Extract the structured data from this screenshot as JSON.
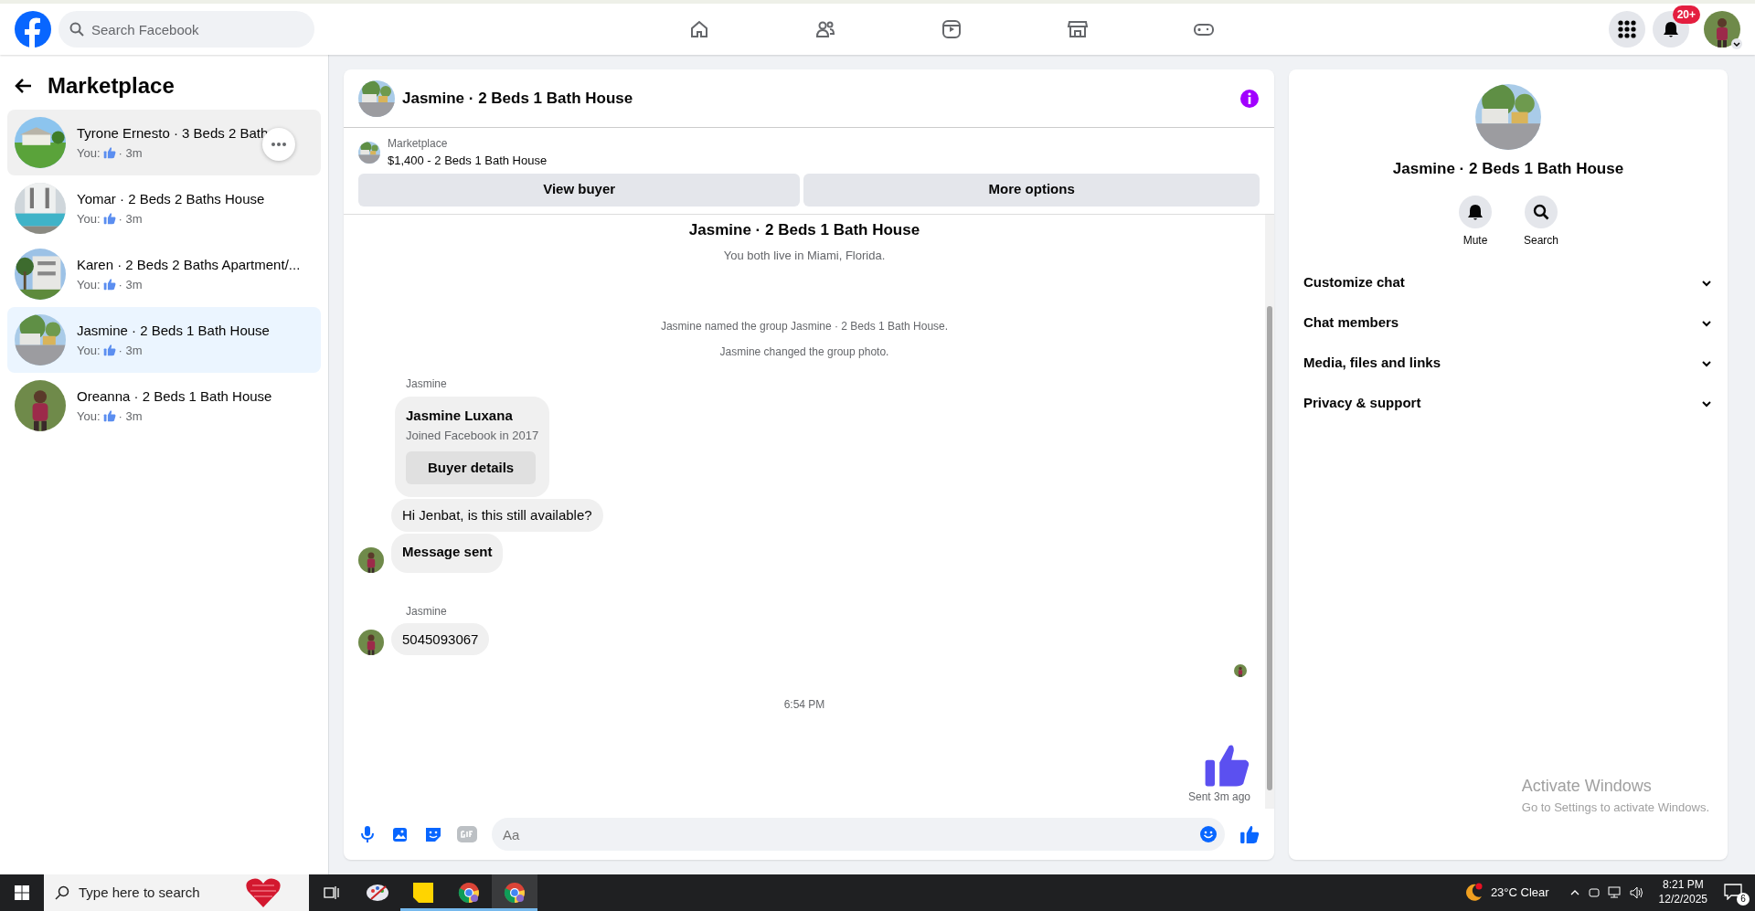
{
  "topbar": {
    "search_placeholder": "Search Facebook",
    "notification_badge": "20+"
  },
  "sidebar": {
    "title": "Marketplace",
    "conversations": [
      {
        "title": "Tyrone Ernesto · 3 Beds 2 Bath",
        "preview": "You:",
        "time": "· 3m",
        "hovered": true,
        "selected": false
      },
      {
        "title": "Yomar · 2 Beds 2 Baths House",
        "preview": "You:",
        "time": "· 3m",
        "hovered": false,
        "selected": false
      },
      {
        "title": "Karen · 2 Beds 2 Baths Apartment/...",
        "preview": "You:",
        "time": "· 3m",
        "hovered": false,
        "selected": false
      },
      {
        "title": "Jasmine · 2 Beds 1 Bath House",
        "preview": "You:",
        "time": "· 3m",
        "hovered": false,
        "selected": true
      },
      {
        "title": "Oreanna · 2 Beds 1 Bath House",
        "preview": "You:",
        "time": "· 3m",
        "hovered": false,
        "selected": false
      }
    ]
  },
  "chat": {
    "title": "Jasmine · 2 Beds 1 Bath House",
    "listing": {
      "label": "Marketplace",
      "detail": "$1,400 - 2 Beds 1 Bath House"
    },
    "actions": [
      "View buyer",
      "More options"
    ],
    "messages": [
      {
        "kind": "heading",
        "text": "Jasmine · 2 Beds 1 Bath House"
      },
      {
        "kind": "note",
        "text": "You both live in Miami, Florida."
      },
      {
        "kind": "event",
        "text": "Jasmine named the group Jasmine · 2 Beds 1 Bath House."
      },
      {
        "kind": "event",
        "text": "Jasmine changed the group photo."
      },
      {
        "kind": "sender",
        "text": "Jasmine"
      },
      {
        "kind": "profile_card",
        "name": "Jasmine Luxana",
        "detail": "Joined Facebook in 2017",
        "button": "Buyer details"
      },
      {
        "kind": "bubble",
        "text": "Hi Jenbat, is this still available?",
        "avatar": false,
        "bold": false
      },
      {
        "kind": "bubble",
        "text": "Message sent",
        "avatar": true,
        "bold": true
      },
      {
        "kind": "sender",
        "text": "Jasmine"
      },
      {
        "kind": "bubble",
        "text": "5045093067",
        "avatar": true,
        "bold": false
      },
      {
        "kind": "seen"
      },
      {
        "kind": "time",
        "text": "6:54 PM"
      },
      {
        "kind": "like",
        "status": "Sent 3m ago"
      }
    ],
    "composer_placeholder": "Aa"
  },
  "info": {
    "title": "Jasmine · 2 Beds 1 Bath House",
    "actions": [
      {
        "kind": "bell",
        "label": "Mute"
      },
      {
        "kind": "search",
        "label": "Search"
      }
    ],
    "sections": [
      {
        "label": "Customize chat",
        "expanded": false
      },
      {
        "label": "Chat members",
        "expanded": false
      },
      {
        "label": "Media, files and links",
        "expanded": false
      },
      {
        "label": "Privacy & support",
        "expanded": false
      }
    ]
  },
  "watermark": {
    "title": "Activate Windows",
    "detail": "Go to Settings to activate Windows."
  },
  "taskbar": {
    "search_placeholder": "Type here to search",
    "apps": [
      {
        "kind": "taskview",
        "running": false,
        "selected": false
      },
      {
        "kind": "paint",
        "running": false,
        "selected": false
      },
      {
        "kind": "notes",
        "running": true,
        "selected": false
      },
      {
        "kind": "chrome",
        "running": true,
        "selected": false
      },
      {
        "kind": "chrome",
        "running": true,
        "selected": true
      }
    ],
    "weather": "23°C Clear",
    "time": "8:21 PM",
    "date": "12/2/2025",
    "notifications": "6"
  }
}
